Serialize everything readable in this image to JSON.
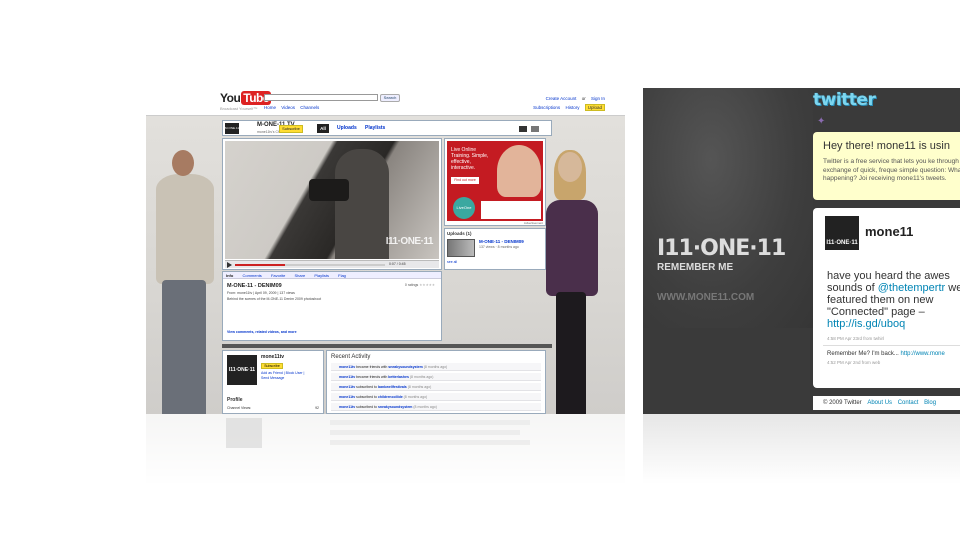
{
  "youtube": {
    "logo_you": "You",
    "logo_tube": "Tube",
    "tagline": "Broadcast Yourself™",
    "search_button": "Search",
    "nav": [
      "Home",
      "Videos",
      "Channels"
    ],
    "account_links": [
      "Create Account",
      "or",
      "Sign In"
    ],
    "account_links2": [
      "Subscriptions",
      "History"
    ],
    "upload_button": "Upload",
    "channel": {
      "logo": "M·ONE·11",
      "name": "M-ONE-11 TV",
      "subtitle": "mone11tv's Channel",
      "subscribe": "Subscribe",
      "tab_all": "All",
      "tab_uploads": "Uploads",
      "tab_playlists": "Playlists"
    },
    "player": {
      "watermark": "I11·ONE·11",
      "time": "0:07 / 0:45"
    },
    "ad": {
      "text": "Live Online Training. Simple, effective, interactive.",
      "find_more": "Find out more",
      "badge": "LiveOne",
      "label": "Advertisement"
    },
    "uploads": {
      "heading": "Uploads (1)",
      "title": "M-ONE-11 - DENIM09",
      "meta": "137 views · 8 months ago",
      "see_all": "see all"
    },
    "info": {
      "tabs": [
        "Info",
        "Comments",
        "Favorite",
        "Share",
        "Playlists",
        "Flag"
      ],
      "title": "M-ONE-11 - DENIM09",
      "ratings": "0 ratings",
      "from": "From: mone11tv | April 09, 2009 | 137 views",
      "desc": "Behind the scenes of the M-ONE-11 Denim 2009 photoshoot",
      "more": "View comments, related videos, and more"
    },
    "profile": {
      "avatar": "I11·ONE·11",
      "name": "mone11tv",
      "subscribe": "Subscribe",
      "links": [
        "Add as Friend | Block User |",
        "Send Message"
      ],
      "heading": "Profile",
      "views_label": "Channel Views:",
      "views_value": "92"
    },
    "activity": {
      "heading": "Recent Activity",
      "rows": [
        {
          "user": "mone11tv",
          "action": "became friends with",
          "target": "sneakysoundsystem",
          "ago": "(8 months ago)"
        },
        {
          "user": "mone11tv",
          "action": "became friends with",
          "target": "betterlashes",
          "ago": "(8 months ago)"
        },
        {
          "user": "mone11tv",
          "action": "subscribed to",
          "target": "bankwellfestivals",
          "ago": "(8 months ago)"
        },
        {
          "user": "mone11tv",
          "action": "subscribed to",
          "target": "childrencollide",
          "ago": "(8 months ago)"
        },
        {
          "user": "mone11tv",
          "action": "subscribed to",
          "target": "sneakysoundsystem",
          "ago": "(8 months ago)"
        }
      ]
    }
  },
  "twitter": {
    "logo": "twitter",
    "brand": "I11·ONE·11",
    "tagline": "REMEMBER ME",
    "site": "WWW.MONE11.COM",
    "hello_title": "Hey there! mone11 is usin",
    "hello_text": "Twitter is a free service that lets you ke through the exchange of quick, freque simple question: What's happening? Joi receiving mone11's tweets.",
    "avatar_label": "I11·ONE·11",
    "handle": "mone11",
    "tweet_pre": "have you heard the awes sounds of ",
    "tweet_mention": "@thetempertr",
    "tweet_mid": " we've featured them on new \"Connected\" page – ",
    "tweet_link": "http://is.gd/uboq",
    "tweet_meta": "4:58 PM Apr 23rd from twhirl",
    "prev_text": "Remember Me? I'm back... ",
    "prev_link": "http://www.mone",
    "prev_meta": "4:52 PM Apr 2nd from web",
    "footer_copy": "© 2009 Twitter",
    "footer_links": [
      "About Us",
      "Contact",
      "Blog"
    ]
  }
}
